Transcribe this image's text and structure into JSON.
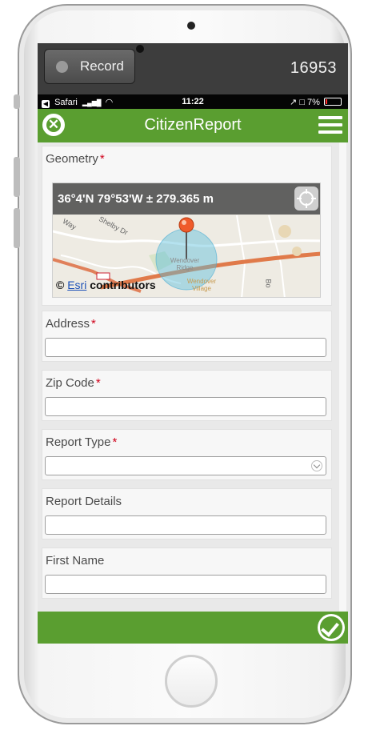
{
  "record": {
    "label": "Record",
    "counter": "16953"
  },
  "status_bar": {
    "carrier": "Safari",
    "signal": "▂▄▆█",
    "wifi": "◠",
    "time": "11:22",
    "indicators": "↗ □",
    "battery": "7%"
  },
  "header": {
    "title": "CitizenReport",
    "close_icon": "✕"
  },
  "form": {
    "geometry": {
      "label": "Geometry",
      "required": "*",
      "coordinates": "36°4'N 79°53'W ± 279.365 m"
    },
    "map": {
      "attribution_prefix": "© ",
      "attribution_link": "Esri",
      "attribution_suffix": " contributors",
      "labels": [
        "Shelby Dr",
        "Way",
        "Wendover Ridge",
        "Wendover Village",
        "Bo"
      ]
    },
    "fields": [
      {
        "label": "Address",
        "required": "*",
        "value": ""
      },
      {
        "label": "Zip Code",
        "required": "*",
        "value": ""
      },
      {
        "label": "Report Type",
        "required": "*",
        "value": ""
      },
      {
        "label": "Report Details",
        "required": "",
        "value": ""
      },
      {
        "label": "First Name",
        "required": "",
        "value": ""
      }
    ]
  },
  "colors": {
    "app_green": "#5a9e30",
    "required_red": "#d0021b",
    "esri_link": "#1a4fb7"
  }
}
